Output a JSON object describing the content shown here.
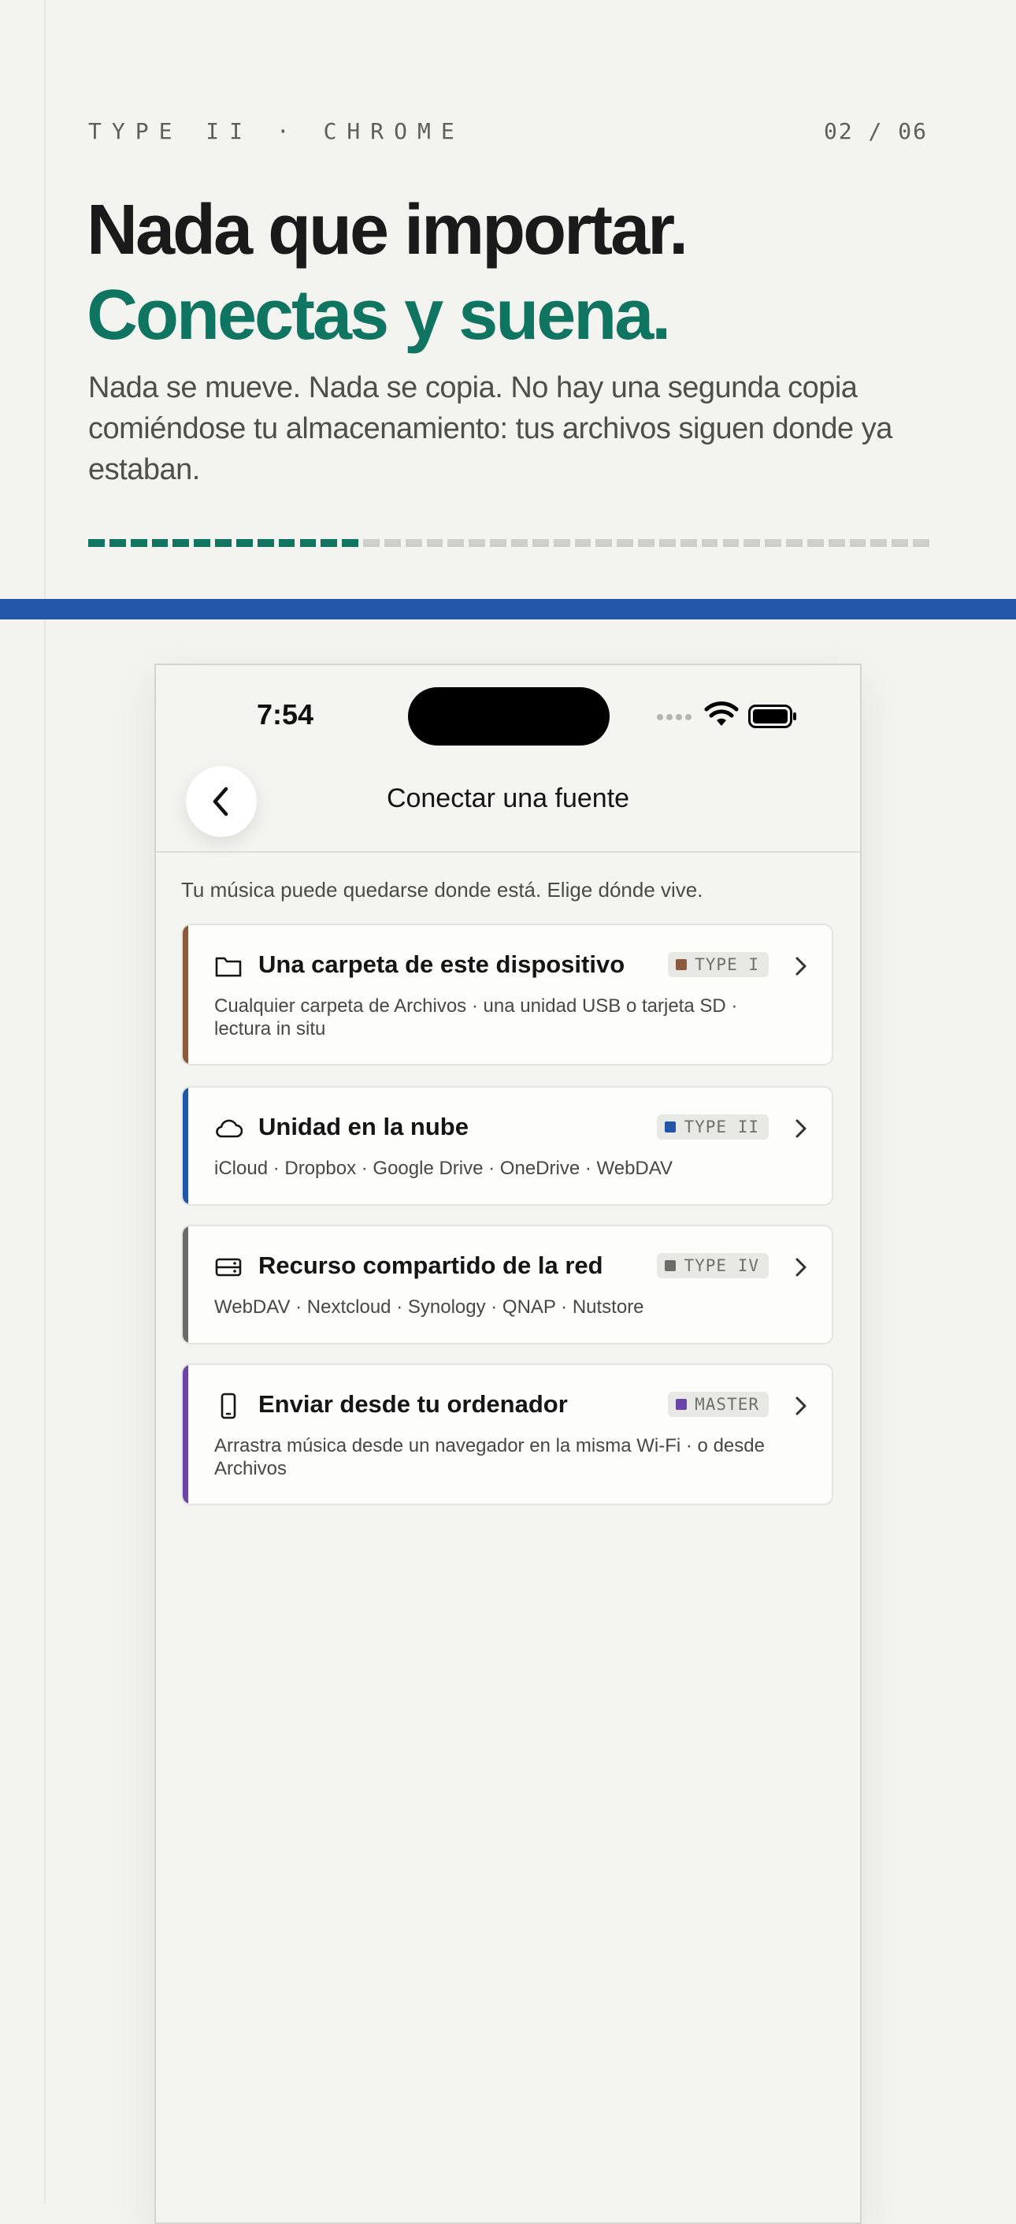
{
  "header": {
    "eyebrow": "TYPE II · CHROME",
    "counter": "02 / 06",
    "headline_line1": "Nada que importar.",
    "headline_line2": "Conectas y suena.",
    "lede": "Nada se mueve. Nada se copia. No hay una segunda copia comiéndose tu almacenamiento: tus archivos siguen donde ya estaban.",
    "progress": {
      "filled_segments": 13,
      "total_segments": 40
    },
    "colors": {
      "accent_green": "#0f7460",
      "band_blue": "#2356a8"
    }
  },
  "phone": {
    "status_bar": {
      "time": "7:54"
    },
    "nav": {
      "title": "Conectar una fuente",
      "back_icon": "chevron-left-icon"
    },
    "intro": "Tu música puede quedarse donde está. Elige dónde vive.",
    "sources": [
      {
        "icon": "folder-icon",
        "title": "Una carpeta de este dispositivo",
        "badge": "TYPE I",
        "color": "#8a5a3a",
        "description": "Cualquier carpeta de Archivos · una unidad USB o tarjeta SD · lectura in situ"
      },
      {
        "icon": "cloud-icon",
        "title": "Unidad en la nube",
        "badge": "TYPE II",
        "color": "#2356a8",
        "description": "iCloud · Dropbox · Google Drive · OneDrive · WebDAV"
      },
      {
        "icon": "server-icon",
        "title": "Recurso compartido de la red",
        "badge": "TYPE IV",
        "color": "#6b6b68",
        "description": "WebDAV · Nextcloud · Synology · QNAP · Nutstore"
      },
      {
        "icon": "phone-icon",
        "title": "Enviar desde tu ordenador",
        "badge": "MASTER",
        "color": "#6a44a8",
        "description": "Arrastra música desde un navegador en la misma Wi-Fi · o desde Archivos"
      }
    ]
  }
}
